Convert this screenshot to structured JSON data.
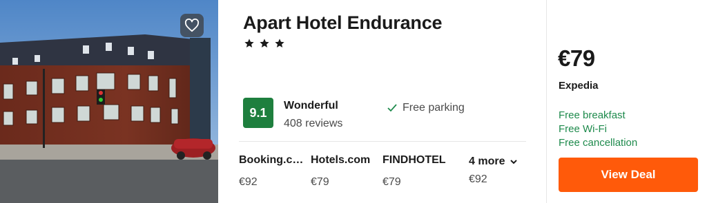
{
  "hotel": {
    "name": "Apart Hotel Endurance",
    "star_count": 3
  },
  "rating": {
    "score": "9.1",
    "label": "Wonderful",
    "reviews": "408 reviews"
  },
  "amenity": {
    "label": "Free parking",
    "icon": "check-icon"
  },
  "offers": [
    {
      "provider": "Booking.com",
      "price": "€92"
    },
    {
      "provider": "Hotels.com",
      "price": "€79"
    },
    {
      "provider": "FINDHOTEL",
      "price": "€79"
    }
  ],
  "more_offers": {
    "label": "4 more",
    "price": "€92",
    "icon": "chevron-down-icon"
  },
  "deal": {
    "price": "€79",
    "provider": "Expedia",
    "perks": [
      "Free breakfast",
      "Free Wi-Fi",
      "Free cancellation"
    ],
    "button_label": "View Deal"
  },
  "favorite": {
    "icon": "heart-outline-icon"
  },
  "colors": {
    "rating_badge": "#1e7f3e",
    "perk_text": "#1e8a4c",
    "deal_button": "#ff5a0a"
  }
}
